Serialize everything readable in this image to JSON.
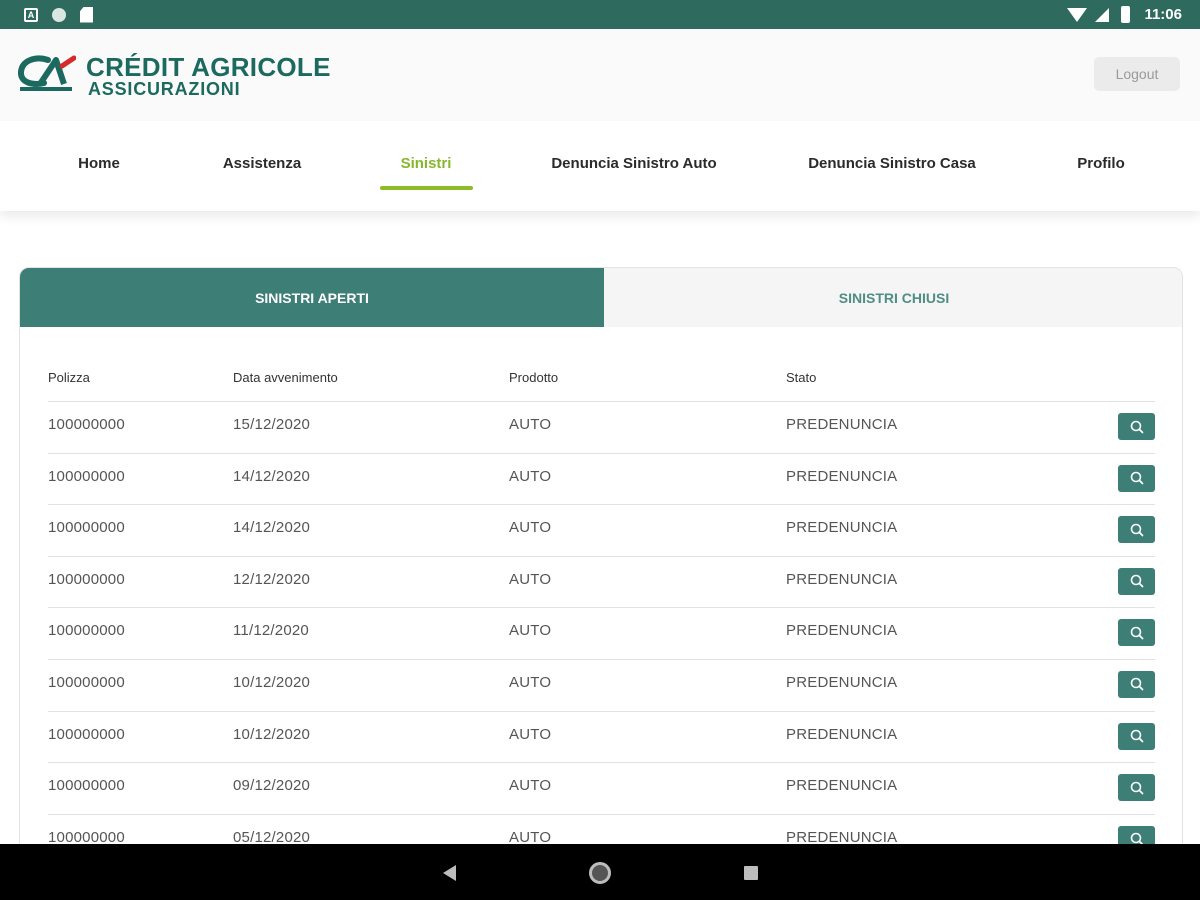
{
  "status_bar": {
    "time": "11:06",
    "badge_letter": "A"
  },
  "header": {
    "logo_line1": "CRÉDIT AGRICOLE",
    "logo_line2": "ASSICURAZIONI",
    "logout_label": "Logout"
  },
  "nav": {
    "items": [
      {
        "label": "Home"
      },
      {
        "label": "Assistenza"
      },
      {
        "label": "Sinistri"
      },
      {
        "label": "Denuncia Sinistro Auto"
      },
      {
        "label": "Denuncia Sinistro Casa"
      },
      {
        "label": "Profilo"
      }
    ],
    "active_index": 2
  },
  "tabs": {
    "open": "SINISTRI APERTI",
    "closed": "SINISTRI CHIUSI",
    "selected": "open"
  },
  "table": {
    "headers": {
      "polizza": "Polizza",
      "data": "Data avvenimento",
      "prodotto": "Prodotto",
      "stato": "Stato"
    },
    "rows": [
      {
        "polizza": "100000000",
        "data": "15/12/2020",
        "prodotto": "AUTO",
        "stato": "PREDENUNCIA"
      },
      {
        "polizza": "100000000",
        "data": "14/12/2020",
        "prodotto": "AUTO",
        "stato": "PREDENUNCIA"
      },
      {
        "polizza": "100000000",
        "data": "14/12/2020",
        "prodotto": "AUTO",
        "stato": "PREDENUNCIA"
      },
      {
        "polizza": "100000000",
        "data": "12/12/2020",
        "prodotto": "AUTO",
        "stato": "PREDENUNCIA"
      },
      {
        "polizza": "100000000",
        "data": "11/12/2020",
        "prodotto": "AUTO",
        "stato": "PREDENUNCIA"
      },
      {
        "polizza": "100000000",
        "data": "10/12/2020",
        "prodotto": "AUTO",
        "stato": "PREDENUNCIA"
      },
      {
        "polizza": "100000000",
        "data": "10/12/2020",
        "prodotto": "AUTO",
        "stato": "PREDENUNCIA"
      },
      {
        "polizza": "100000000",
        "data": "09/12/2020",
        "prodotto": "AUTO",
        "stato": "PREDENUNCIA"
      },
      {
        "polizza": "100000000",
        "data": "05/12/2020",
        "prodotto": "AUTO",
        "stato": "PREDENUNCIA"
      }
    ]
  },
  "colors": {
    "brand_green": "#2e6b5e",
    "tab_active": "#3d7e76",
    "nav_active": "#86b82c"
  },
  "icons": {
    "row_action": "search-icon",
    "android_back": "back-icon",
    "android_home": "home-icon",
    "android_recents": "recents-icon"
  }
}
